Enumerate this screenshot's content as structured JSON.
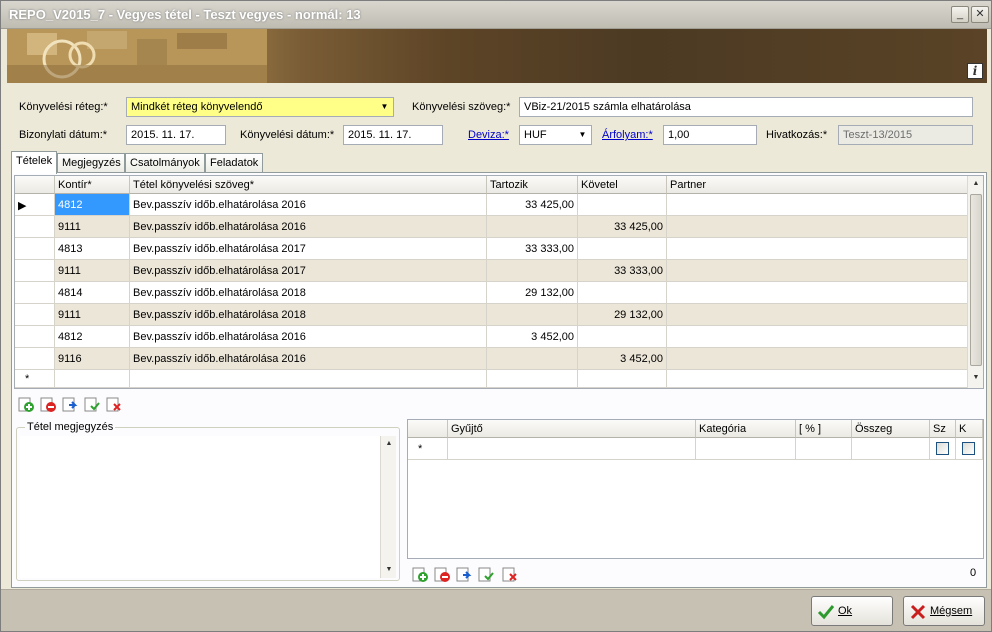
{
  "window": {
    "title": "REPO_V2015_7 - Vegyes tétel - Teszt vegyes - normál: 13"
  },
  "form": {
    "layer_label": "Könyvelési réteg:*",
    "layer_value": "Mindkét réteg könyvelendő",
    "text_label": "Könyvelési szöveg:*",
    "text_value": "VBiz-21/2015 számla elhatárolása",
    "doc_date_label": "Bizonylati dátum:*",
    "doc_date_value": "2015. 11. 17.",
    "post_date_label": "Könyvelési dátum:*",
    "post_date_value": "2015. 11. 17.",
    "currency_label": "Deviza:*",
    "currency_value": "HUF",
    "rate_label": "Árfolyam:*",
    "rate_value": "1,00",
    "ref_label": "Hivatkozás:*",
    "ref_value": "Teszt-13/2015"
  },
  "tabs": [
    "Tételek",
    "Megjegyzés",
    "Csatolmányok",
    "Feladatok"
  ],
  "grid": {
    "headers": [
      "Kontír*",
      "Tétel könyvelési szöveg*",
      "Tartozik",
      "Követel",
      "Partner"
    ],
    "rows": [
      {
        "kontir": "4812",
        "text": "Bev.passzív időb.elhatárolása 2016",
        "debit": "33 425,00",
        "credit": "",
        "partner": ""
      },
      {
        "kontir": "9111",
        "text": "Bev.passzív időb.elhatárolása 2016",
        "debit": "",
        "credit": "33 425,00",
        "partner": ""
      },
      {
        "kontir": "4813",
        "text": "Bev.passzív időb.elhatárolása 2017",
        "debit": "33 333,00",
        "credit": "",
        "partner": ""
      },
      {
        "kontir": "9111",
        "text": "Bev.passzív időb.elhatárolása 2017",
        "debit": "",
        "credit": "33 333,00",
        "partner": ""
      },
      {
        "kontir": "4814",
        "text": "Bev.passzív időb.elhatárolása 2018",
        "debit": "29 132,00",
        "credit": "",
        "partner": ""
      },
      {
        "kontir": "9111",
        "text": "Bev.passzív időb.elhatárolása 2018",
        "debit": "",
        "credit": "29 132,00",
        "partner": ""
      },
      {
        "kontir": "4812",
        "text": "Bev.passzív időb.elhatárolása 2016",
        "debit": "3 452,00",
        "credit": "",
        "partner": ""
      },
      {
        "kontir": "9116",
        "text": "Bev.passzív időb.elhatárolása 2016",
        "debit": "",
        "credit": "3 452,00",
        "partner": ""
      }
    ],
    "new_row_marker": "*"
  },
  "note": {
    "label": "Tétel megjegyzés"
  },
  "subgrid": {
    "headers": [
      "Gyűjtő",
      "Kategória",
      "[ % ]",
      "Összeg",
      "Sz",
      "K"
    ],
    "new_row_marker": "*",
    "count": "0"
  },
  "buttons": {
    "ok": "Ok",
    "cancel": "Mégsem"
  }
}
